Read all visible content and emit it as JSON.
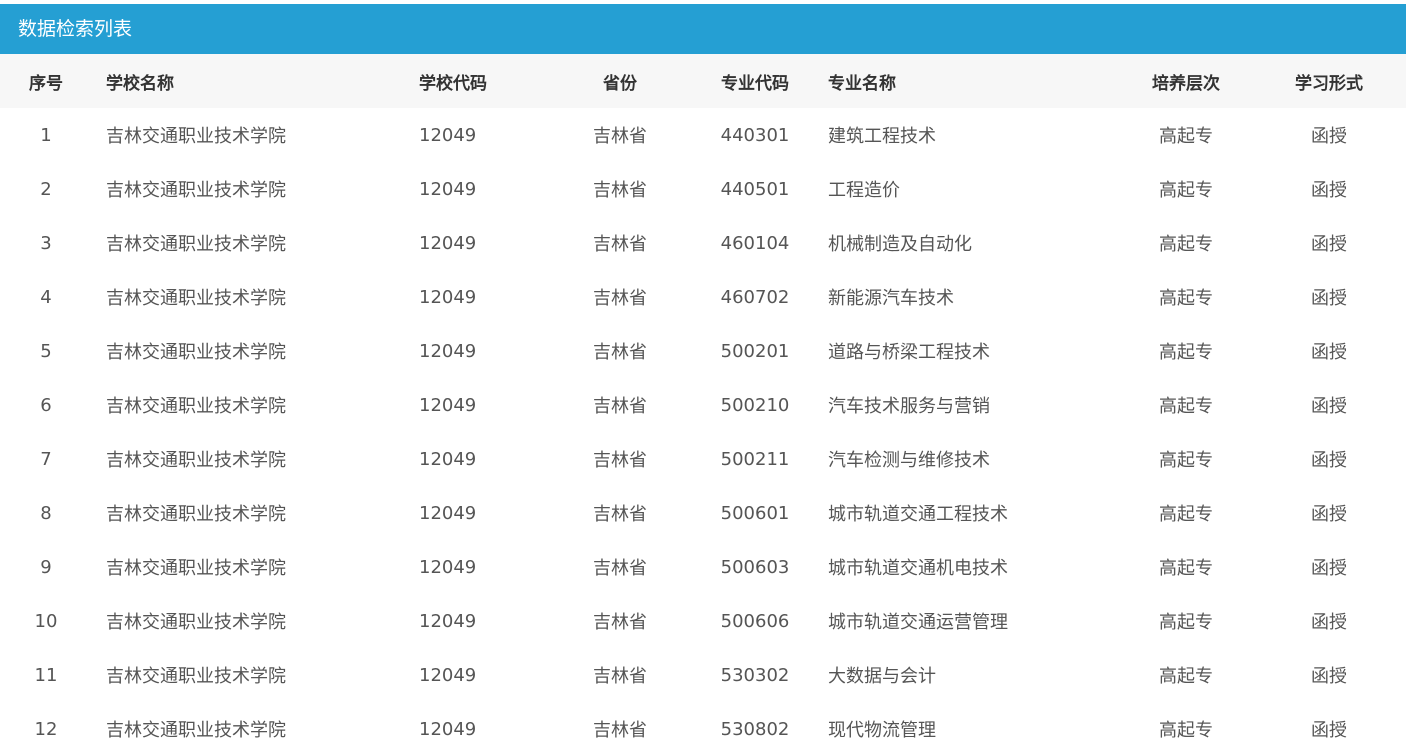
{
  "panel": {
    "title": "数据检索列表"
  },
  "table": {
    "headers": {
      "index": "序号",
      "school_name": "学校名称",
      "school_code": "学校代码",
      "province": "省份",
      "major_code": "专业代码",
      "major_name": "专业名称",
      "level": "培养层次",
      "study_mode": "学习形式"
    },
    "rows": [
      {
        "index": "1",
        "school_name": "吉林交通职业技术学院",
        "school_code": "12049",
        "province": "吉林省",
        "major_code": "440301",
        "major_name": "建筑工程技术",
        "level": "高起专",
        "study_mode": "函授"
      },
      {
        "index": "2",
        "school_name": "吉林交通职业技术学院",
        "school_code": "12049",
        "province": "吉林省",
        "major_code": "440501",
        "major_name": "工程造价",
        "level": "高起专",
        "study_mode": "函授"
      },
      {
        "index": "3",
        "school_name": "吉林交通职业技术学院",
        "school_code": "12049",
        "province": "吉林省",
        "major_code": "460104",
        "major_name": "机械制造及自动化",
        "level": "高起专",
        "study_mode": "函授"
      },
      {
        "index": "4",
        "school_name": "吉林交通职业技术学院",
        "school_code": "12049",
        "province": "吉林省",
        "major_code": "460702",
        "major_name": "新能源汽车技术",
        "level": "高起专",
        "study_mode": "函授"
      },
      {
        "index": "5",
        "school_name": "吉林交通职业技术学院",
        "school_code": "12049",
        "province": "吉林省",
        "major_code": "500201",
        "major_name": "道路与桥梁工程技术",
        "level": "高起专",
        "study_mode": "函授"
      },
      {
        "index": "6",
        "school_name": "吉林交通职业技术学院",
        "school_code": "12049",
        "province": "吉林省",
        "major_code": "500210",
        "major_name": "汽车技术服务与营销",
        "level": "高起专",
        "study_mode": "函授"
      },
      {
        "index": "7",
        "school_name": "吉林交通职业技术学院",
        "school_code": "12049",
        "province": "吉林省",
        "major_code": "500211",
        "major_name": "汽车检测与维修技术",
        "level": "高起专",
        "study_mode": "函授"
      },
      {
        "index": "8",
        "school_name": "吉林交通职业技术学院",
        "school_code": "12049",
        "province": "吉林省",
        "major_code": "500601",
        "major_name": "城市轨道交通工程技术",
        "level": "高起专",
        "study_mode": "函授"
      },
      {
        "index": "9",
        "school_name": "吉林交通职业技术学院",
        "school_code": "12049",
        "province": "吉林省",
        "major_code": "500603",
        "major_name": "城市轨道交通机电技术",
        "level": "高起专",
        "study_mode": "函授"
      },
      {
        "index": "10",
        "school_name": "吉林交通职业技术学院",
        "school_code": "12049",
        "province": "吉林省",
        "major_code": "500606",
        "major_name": "城市轨道交通运营管理",
        "level": "高起专",
        "study_mode": "函授"
      },
      {
        "index": "11",
        "school_name": "吉林交通职业技术学院",
        "school_code": "12049",
        "province": "吉林省",
        "major_code": "530302",
        "major_name": "大数据与会计",
        "level": "高起专",
        "study_mode": "函授"
      },
      {
        "index": "12",
        "school_name": "吉林交通职业技术学院",
        "school_code": "12049",
        "province": "吉林省",
        "major_code": "530802",
        "major_name": "现代物流管理",
        "level": "高起专",
        "study_mode": "函授"
      }
    ]
  },
  "colors": {
    "header_bar": "#259fd3",
    "table_head_bg": "#f7f7f7",
    "cell_text": "#555555"
  }
}
